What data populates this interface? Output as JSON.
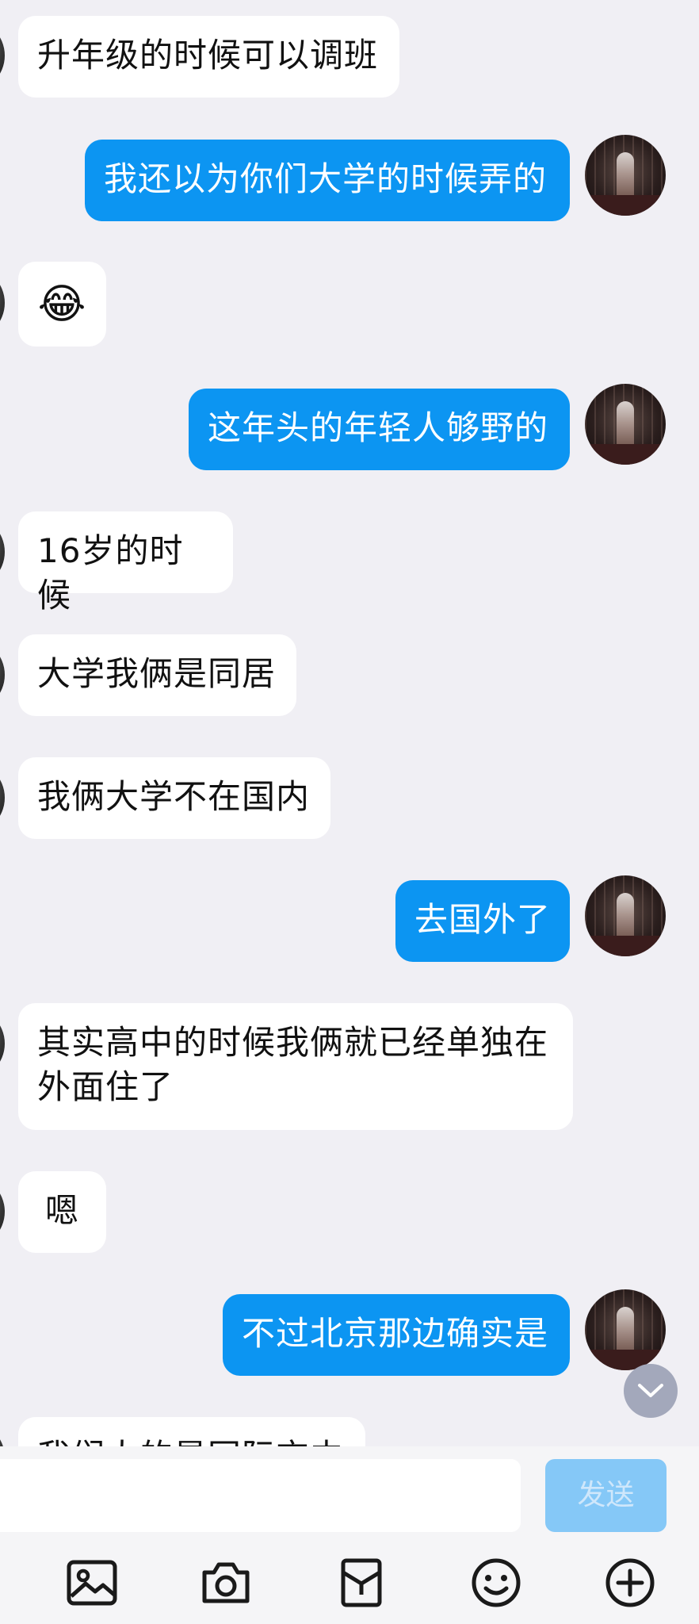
{
  "messages": [
    {
      "side": "in",
      "text": "升年级的时候可以调班"
    },
    {
      "side": "out",
      "text": "我还以为你们大学的时候弄的"
    },
    {
      "side": "in",
      "text": "😂"
    },
    {
      "side": "out",
      "text": "这年头的年轻人够野的"
    },
    {
      "side": "in",
      "text": "16岁的时候"
    },
    {
      "side": "in",
      "text": "大学我俩是同居"
    },
    {
      "side": "in",
      "text": "我俩大学不在国内"
    },
    {
      "side": "out",
      "text": "去国外了"
    },
    {
      "side": "in",
      "text": "其实高中的时候我俩就已经单独在\n外面住了"
    },
    {
      "side": "in",
      "text": "嗯"
    },
    {
      "side": "out",
      "text": "不过北京那边确实是"
    },
    {
      "side": "in",
      "text": "我们大的是国际交中"
    }
  ],
  "input": {
    "send_label": "发送"
  },
  "toolbar": {
    "icons": [
      "image-icon",
      "camera-icon",
      "red-packet-icon",
      "emoji-icon",
      "plus-icon"
    ]
  },
  "colors": {
    "outgoing_bubble": "#0c95f2",
    "incoming_bubble": "#ffffff",
    "background": "#f0eff4",
    "send_disabled": "#85c8f7"
  }
}
